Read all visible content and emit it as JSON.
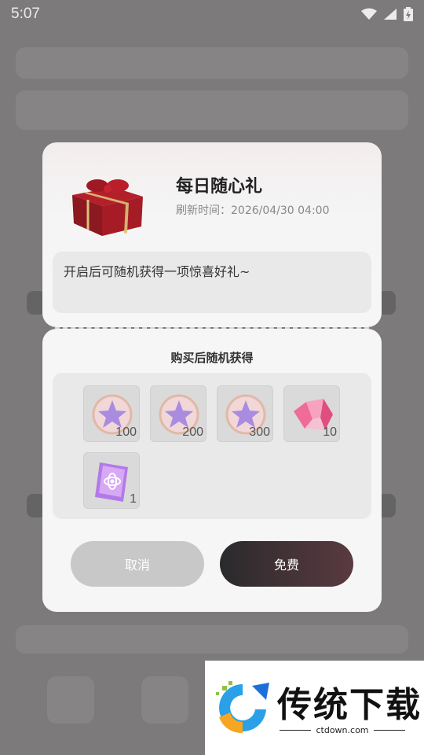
{
  "status_bar": {
    "time": "5:07",
    "icons": [
      "wifi-icon",
      "signal-icon",
      "battery-charging-icon"
    ]
  },
  "dialog": {
    "title": "每日随心礼",
    "refresh_label": "刷新时间：",
    "refresh_time": "2026/04/30 04:00",
    "description": "开启后可随机获得一项惊喜好礼~",
    "section_title": "购买后随机获得",
    "rewards": [
      {
        "icon": "star-coin-icon",
        "count": "100"
      },
      {
        "icon": "star-coin-icon",
        "count": "200"
      },
      {
        "icon": "star-coin-icon",
        "count": "300"
      },
      {
        "icon": "pink-crystal-icon",
        "count": "10"
      },
      {
        "icon": "purple-card-icon",
        "count": "1"
      }
    ],
    "cancel_label": "取消",
    "free_label": "免费"
  },
  "watermark": {
    "brand": "传统下载",
    "url": "ctdown.com"
  },
  "colors": {
    "accent_dark": "#2a2a2c",
    "accent_wine": "#5a3a40",
    "cancel_gray": "#c8c8c8"
  }
}
